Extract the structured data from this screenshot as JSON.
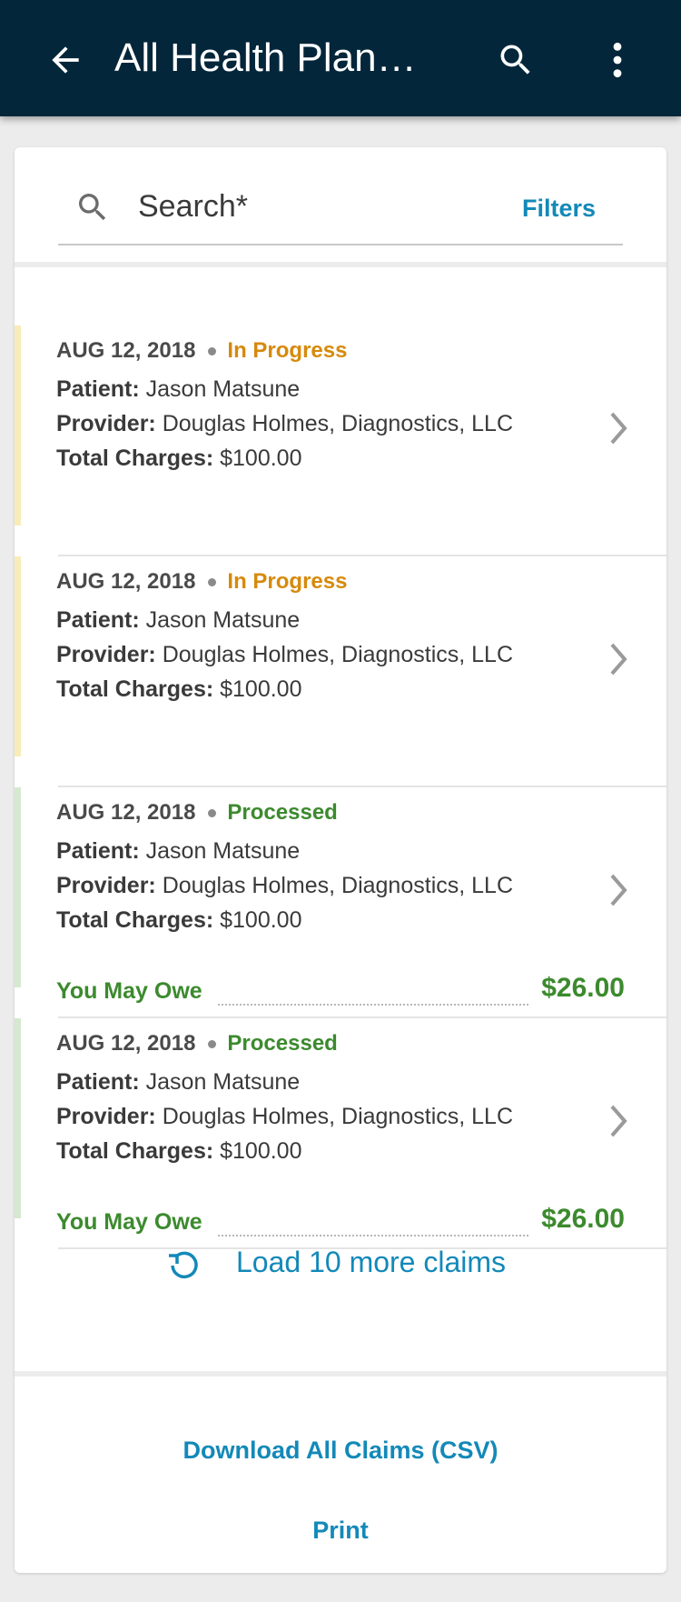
{
  "header": {
    "title": "All Health Plan…",
    "back_icon": "arrow-left-icon",
    "search_icon": "search-icon",
    "more_icon": "more-vert-icon"
  },
  "search": {
    "placeholder": "Search*",
    "filters_label": "Filters"
  },
  "claims": [
    {
      "date": "AUG 12, 2018",
      "status": "In Progress",
      "patient_label": "Patient:",
      "patient": "Jason Matsune",
      "provider_label": "Provider:",
      "provider": "Douglas Holmes, Diagnostics, LLC",
      "charges_label": "Total Charges:",
      "charges": "$100.00"
    },
    {
      "date": "AUG 12, 2018",
      "status": "In Progress",
      "patient_label": "Patient:",
      "patient": "Jason Matsune",
      "provider_label": "Provider:",
      "provider": "Douglas Holmes, Diagnostics, LLC",
      "charges_label": "Total Charges:",
      "charges": "$100.00"
    },
    {
      "date": "AUG 12, 2018",
      "status": "Processed",
      "patient_label": "Patient:",
      "patient": "Jason Matsune",
      "provider_label": "Provider:",
      "provider": "Douglas Holmes, Diagnostics, LLC",
      "charges_label": "Total Charges:",
      "charges": "$100.00",
      "owe_label": "You May Owe",
      "owe_amount": "$26.00"
    },
    {
      "date": "AUG 12, 2018",
      "status": "Processed",
      "patient_label": "Patient:",
      "patient": "Jason Matsune",
      "provider_label": "Provider:",
      "provider": "Douglas Holmes, Diagnostics, LLC",
      "charges_label": "Total Charges:",
      "charges": "$100.00",
      "owe_label": "You May Owe",
      "owe_amount": "$26.00"
    }
  ],
  "load_more": {
    "label": "Load 10 more claims",
    "icon": "refresh-icon"
  },
  "actions": {
    "download_label": "Download All Claims (CSV)",
    "print_label": "Print"
  },
  "colors": {
    "header_bg": "#03263a",
    "link": "#1389b8",
    "in_progress": "#d68a0c",
    "processed": "#3c8a2e",
    "in_progress_bar": "#f8ecb8",
    "processed_bar": "#d5e9d0"
  }
}
